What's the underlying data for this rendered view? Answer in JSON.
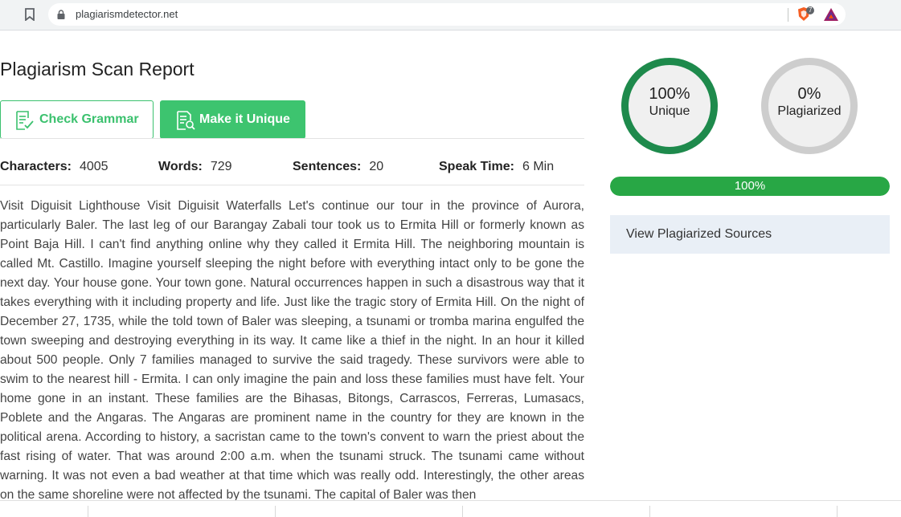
{
  "browser": {
    "url": "plagiarismdetector.net",
    "brave_badge": "7"
  },
  "page": {
    "title": "Plagiarism Scan Report",
    "buttons": {
      "check_grammar": "Check Grammar",
      "make_unique": "Make it Unique"
    },
    "stats": {
      "characters_label": "Characters:",
      "characters_value": "4005",
      "words_label": "Words:",
      "words_value": "729",
      "sentences_label": "Sentences:",
      "sentences_value": "20",
      "speak_label": "Speak Time:",
      "speak_value": "6 Min"
    },
    "article": "Visit Diguisit Lighthouse Visit Diguisit Waterfalls Let's continue our tour in the province of Aurora, particularly Baler. The last leg of our Barangay Zabali tour took us to Ermita Hill or formerly known as Point Baja Hill. I can't find anything online why they called it Ermita Hill. The neighboring mountain is called Mt. Castillo. Imagine yourself sleeping the night before with everything intact only to be gone the next day. Your house gone. Your town gone. Natural occurrences happen in such a disastrous way that it takes everything with it including property and life. Just like the tragic story of Ermita Hill. On the night of December 27, 1735, while the told town of Baler was sleeping, a tsunami or tromba marina engulfed the town sweeping and destroying everything in its way. It came like a thief in the night. In an hour it killed about 500 people. Only 7 families managed to survive the said tragedy. These survivors were able to swim to the nearest hill - Ermita. I can only imagine the pain and loss these families must have felt. Your home gone in an instant. These families are the Bihasas, Bitongs, Carrascos, Ferreras, Lumasacs, Poblete and the Angaras. The Angaras are prominent name in the country for they are known in the political arena. According to history, a sacristan came to the town's convent to warn the priest about the fast rising of water. That was around 2:00 a.m. when the tsunami struck. The tsunami came without warning. It was not even a bad weather at that time which was really odd. Interestingly, the other areas on the same shoreline were not affected by the tsunami. The capital of Baler was then"
  },
  "results": {
    "unique_pct": "100%",
    "unique_label": "Unique",
    "plagiarized_pct": "0%",
    "plagiarized_label": "Plagiarized",
    "progress_text": "100%",
    "progress_value": 1.0,
    "sources_label": "View Plagiarized Sources"
  },
  "colors": {
    "accent_green": "#3dc46f",
    "ring_green": "#1e8a4c",
    "progress_green": "#28a745"
  },
  "icons": [
    "bookmark-icon",
    "lock-icon",
    "brave-shield-icon",
    "bat-rewards-icon",
    "grammar-check-icon",
    "document-search-icon"
  ]
}
